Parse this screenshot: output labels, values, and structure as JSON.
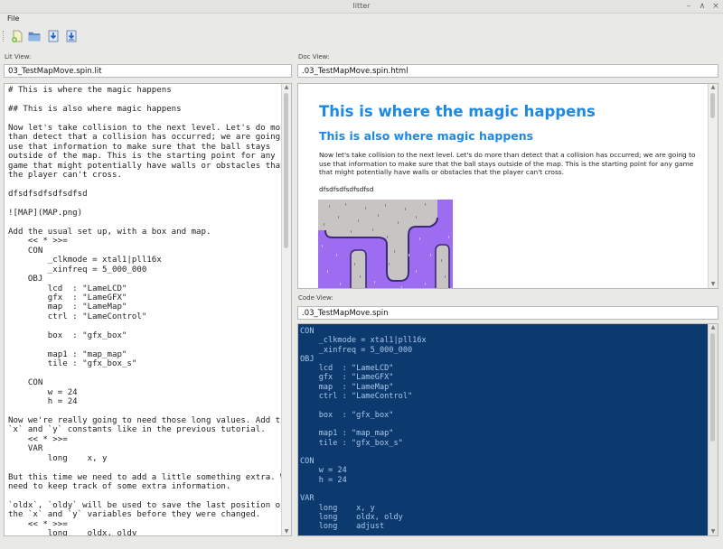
{
  "window": {
    "title": "litter"
  },
  "menu": {
    "file": "File"
  },
  "toolbar": {
    "icons": [
      "new-file-icon",
      "open-folder-icon",
      "save-icon",
      "save-as-icon"
    ]
  },
  "lit": {
    "label": "Lit View:",
    "path": "03_TestMapMove.spin.lit",
    "content": "# This is where the magic happens\n\n## This is also where magic happens\n\nNow let's take collision to the next level. Let's do more\nthan detect that a collision has occurred; we are going to\nuse that information to make sure that the ball stays\noutside of the map. This is the starting point for any\ngame that might potentially have walls or obstacles that\nthe player can't cross.\n\ndfsdfsdfsdfsdfsd\n\n![MAP](MAP.png)\n\nAdd the usual set up, with a box and map.\n    << * >>=\n    CON\n        _clkmode = xtal1|pll16x\n        _xinfreq = 5_000_000\n    OBJ\n        lcd  : \"LameLCD\"\n        gfx  : \"LameGFX\"\n        map  : \"LameMap\"\n        ctrl : \"LameControl\"\n\n        box  : \"gfx_box\"\n\n        map1 : \"map_map\"\n        tile : \"gfx_box_s\"\n\n    CON\n        w = 24\n        h = 24\n\nNow we're really going to need those long values. Add the\n`x` and `y` constants like in the previous tutorial.\n    << * >>=\n    VAR\n        long    x, y\n\nBut this time we need to add a little something extra. We\nneed to keep track of some extra information.\n\n`oldx`, `oldy` will be used to save the last position of\nthe `x` and `y` variables before they were changed.\n    << * >>=\n        long    oldx, oldy"
  },
  "doc": {
    "label": "Doc View:",
    "path": ".03_TestMapMove.spin.html",
    "h1": "This is where the magic happens",
    "h2": "This is also where magic happens",
    "paragraph": "Now let's take collision to the next level. Let's do more than detect that a collision has occurred; we are going to use that information to make sure that the ball stays outside of the map. This is the starting point for any game that might potentially have walls or obstacles that the player can't cross.",
    "line": "dfsdfsdfsdfsdfsd"
  },
  "code": {
    "label": "Code View:",
    "path": ".03_TestMapMove.spin",
    "content": "CON\n    _clkmode = xtal1|pll16x\n    _xinfreq = 5_000_000\nOBJ\n    lcd  : \"LameLCD\"\n    gfx  : \"LameGFX\"\n    map  : \"LameMap\"\n    ctrl : \"LameControl\"\n\n    box  : \"gfx_box\"\n\n    map1 : \"map_map\"\n    tile : \"gfx_box_s\"\n\nCON\n    w = 24\n    h = 24\n\nVAR\n    long    x, y\n    long    oldx, oldy\n    long    adjust"
  },
  "colors": {
    "heading": "#1e88e5",
    "code_bg": "#0d3a6e",
    "code_fg": "#a9c7ea",
    "map_purple": "#9d6cf0",
    "map_grey": "#c9c4c4"
  }
}
